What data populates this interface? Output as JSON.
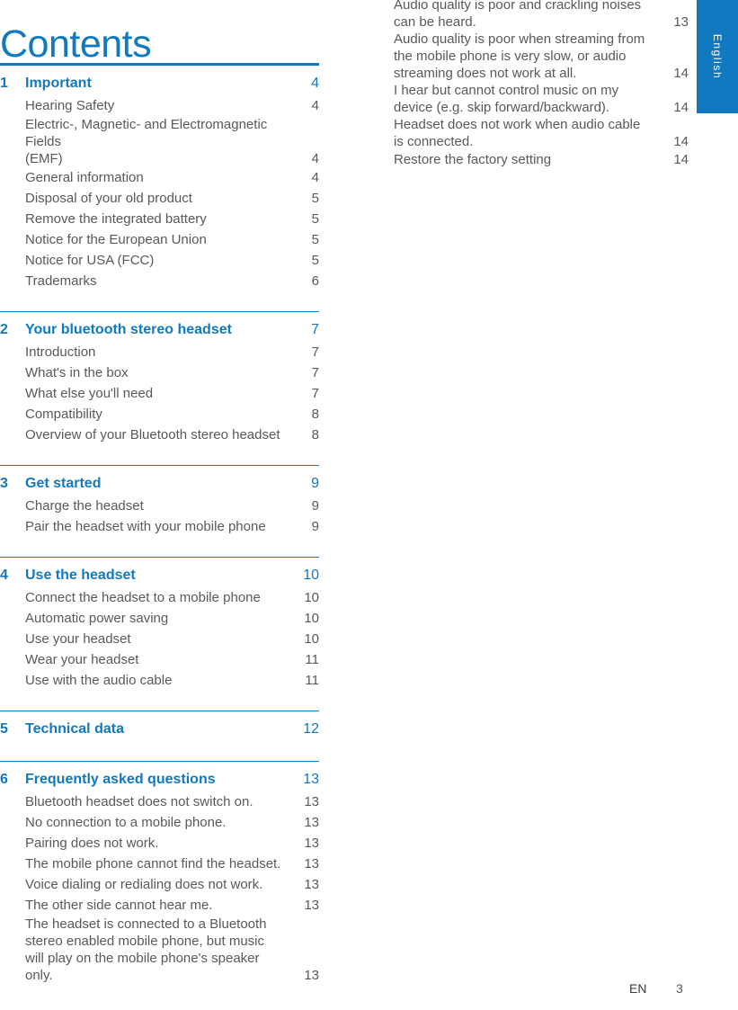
{
  "page": {
    "title": "Contents",
    "language_tab": "English",
    "accent_color": "#1179c0",
    "body_text_color": "#58595b"
  },
  "footer": {
    "language_code": "EN",
    "page_number": "3"
  },
  "toc": {
    "sections": [
      {
        "number": "1",
        "title": "Important",
        "page": "4",
        "rule": "thick",
        "entries": [
          {
            "label": "Hearing Safety",
            "page": "4",
            "lines": [
              "Hearing Safety"
            ]
          },
          {
            "label": "Electric-, Magnetic- and Electromagnetic Fields (EMF)",
            "page": "4",
            "lines": [
              "Electric-, Magnetic- and Electromagnetic Fields",
              "(EMF)"
            ]
          },
          {
            "label": "General information",
            "page": "4",
            "lines": [
              "General information"
            ]
          },
          {
            "label": "Disposal of your old product",
            "page": "5",
            "lines": [
              "Disposal of your old product"
            ]
          },
          {
            "label": "Remove the integrated battery",
            "page": "5",
            "lines": [
              "Remove the integrated battery"
            ]
          },
          {
            "label": "Notice for the European Union",
            "page": "5",
            "lines": [
              "Notice for the European Union"
            ]
          },
          {
            "label": "Notice for USA (FCC)",
            "page": "5",
            "lines": [
              "Notice for USA (FCC)"
            ]
          },
          {
            "label": "Trademarks",
            "page": "6",
            "lines": [
              "Trademarks"
            ]
          }
        ]
      },
      {
        "number": "2",
        "title": "Your bluetooth stereo headset",
        "page": "7",
        "rule": "thin",
        "entries": [
          {
            "label": "Introduction",
            "page": "7",
            "lines": [
              "Introduction"
            ]
          },
          {
            "label": "What's in the box",
            "page": "7",
            "lines": [
              "What's in the box"
            ]
          },
          {
            "label": "What else you'll need",
            "page": "7",
            "lines": [
              "What else you'll need"
            ]
          },
          {
            "label": "Compatibility",
            "page": "8",
            "lines": [
              "Compatibility"
            ]
          },
          {
            "label": "Overview of your Bluetooth stereo headset",
            "page": "8",
            "lines": [
              "Overview of your Bluetooth stereo headset"
            ]
          }
        ]
      },
      {
        "number": "3",
        "title": "Get started",
        "page": "9",
        "rule": "thin",
        "entries": [
          {
            "label": "Charge the headset",
            "page": "9",
            "lines": [
              "Charge the headset"
            ]
          },
          {
            "label": "Pair the headset with your mobile phone",
            "page": "9",
            "lines": [
              "Pair the headset with your mobile phone"
            ]
          }
        ]
      },
      {
        "number": "4",
        "title": "Use the headset",
        "page": "10",
        "rule": "thin",
        "entries": [
          {
            "label": "Connect the headset to a mobile phone",
            "page": "10",
            "lines": [
              "Connect the headset to a mobile phone"
            ]
          },
          {
            "label": "Automatic power saving",
            "page": "10",
            "lines": [
              "Automatic power saving"
            ]
          },
          {
            "label": "Use your headset",
            "page": "10",
            "lines": [
              "Use your headset"
            ]
          },
          {
            "label": "Wear your headset",
            "page": "11",
            "lines": [
              "Wear your headset"
            ]
          },
          {
            "label": "Use with the audio cable",
            "page": "11",
            "lines": [
              "Use with the audio cable"
            ]
          }
        ]
      },
      {
        "number": "5",
        "title": "Technical data",
        "page": "12",
        "rule": "thin",
        "entries": []
      },
      {
        "number": "6",
        "title": "Frequently asked questions",
        "page": "13",
        "rule": "thin",
        "entries": [
          {
            "label": "Bluetooth headset does not switch on.",
            "page": "13",
            "lines": [
              "Bluetooth headset does not switch on."
            ]
          },
          {
            "label": "No connection to a mobile phone.",
            "page": "13",
            "lines": [
              "No connection to a mobile phone."
            ]
          },
          {
            "label": "Pairing does not work.",
            "page": "13",
            "lines": [
              "Pairing does not work."
            ]
          },
          {
            "label": "The mobile phone cannot find the headset.",
            "page": "13",
            "lines": [
              "The mobile phone cannot find the headset."
            ]
          },
          {
            "label": "Voice dialing or redialing does not work.",
            "page": "13",
            "lines": [
              "Voice dialing or redialing does not work."
            ]
          },
          {
            "label": "The other side cannot hear me.",
            "page": "13",
            "lines": [
              "The other side cannot hear me."
            ]
          },
          {
            "label": "The headset is connected to a Bluetooth stereo enabled mobile phone, but music will play on the mobile phone's speaker only.",
            "page": "13",
            "lines": [
              "The headset is connected to a Bluetooth",
              "stereo enabled mobile phone, but music",
              "will play on the mobile phone's speaker only."
            ]
          }
        ]
      }
    ],
    "continued_entries": [
      {
        "label": "Audio quality is poor and crackling noises can be heard.",
        "page": "13",
        "lines": [
          "Audio quality is poor and crackling noises",
          "can be heard."
        ]
      },
      {
        "label": "Audio quality is poor when streaming from the mobile phone is very slow, or audio streaming does not work at all.",
        "page": "14",
        "lines": [
          "Audio quality is poor when streaming from",
          "the mobile phone is very slow, or audio",
          "streaming does not work at all."
        ]
      },
      {
        "label": "I hear but cannot control music on my device (e.g. skip forward/backward).",
        "page": "14",
        "lines": [
          "I hear but cannot control music on my",
          "device (e.g. skip forward/backward)."
        ]
      },
      {
        "label": "Headset does not work when audio cable is connected.",
        "page": "14",
        "lines": [
          "Headset does not work when audio cable",
          "is connected."
        ]
      },
      {
        "label": "Restore the factory setting",
        "page": "14",
        "lines": [
          "Restore the factory setting"
        ]
      }
    ]
  }
}
